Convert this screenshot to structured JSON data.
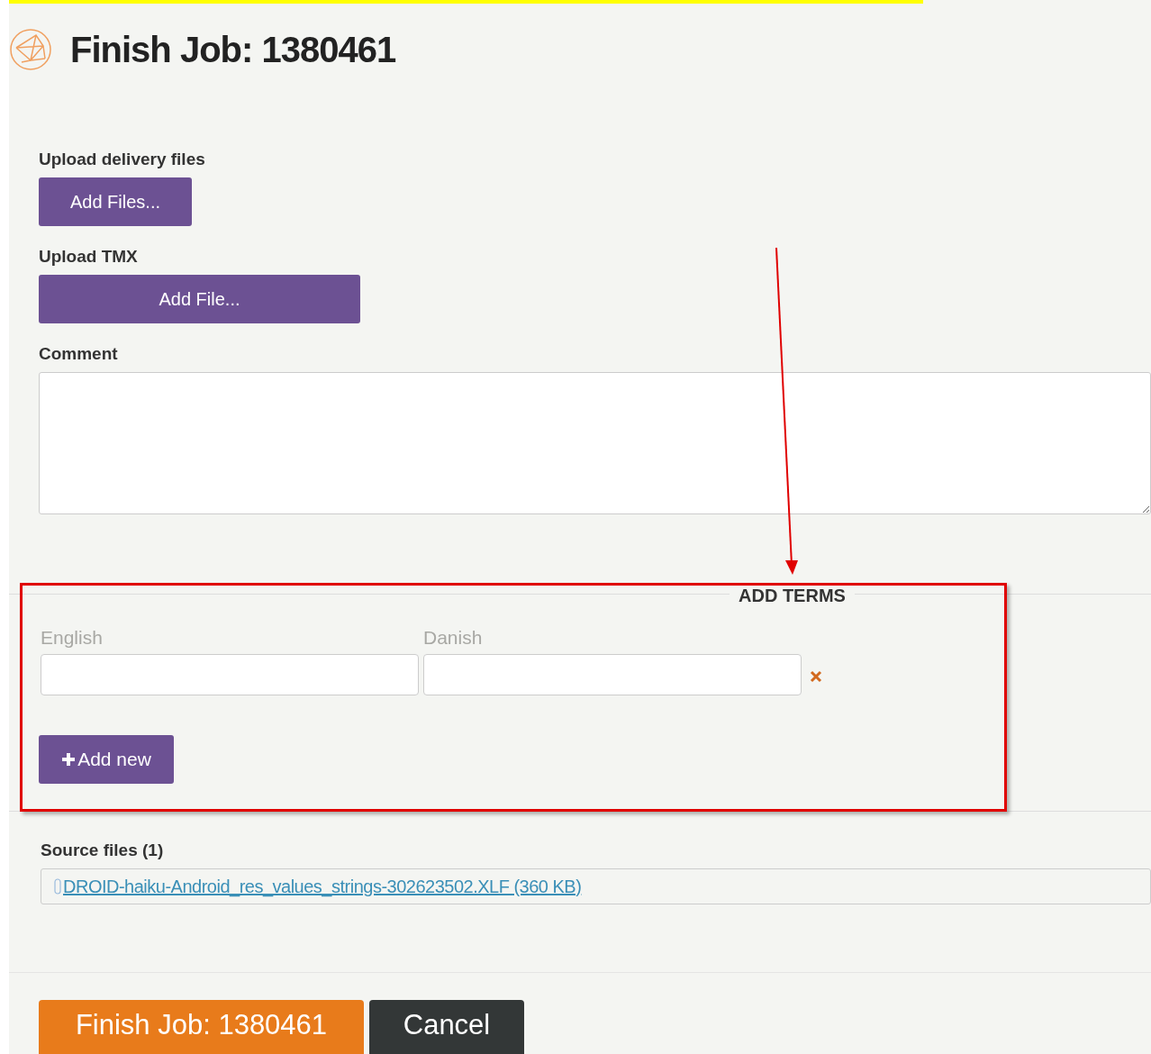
{
  "header": {
    "title": "Finish Job: 1380461"
  },
  "upload_delivery": {
    "label": "Upload delivery files",
    "button": "Add Files..."
  },
  "upload_tmx": {
    "label": "Upload TMX",
    "button": "Add File..."
  },
  "comment": {
    "label": "Comment"
  },
  "add_terms": {
    "legend": "ADD TERMS",
    "columns": [
      "English",
      "Danish"
    ],
    "button": "Add new"
  },
  "source_files": {
    "label": "Source files (1)",
    "link": "DROID-haiku-Android_res_values_strings-302623502.XLF (360 KB)"
  },
  "actions": {
    "finish": "Finish Job: 1380461",
    "cancel": "Cancel"
  }
}
